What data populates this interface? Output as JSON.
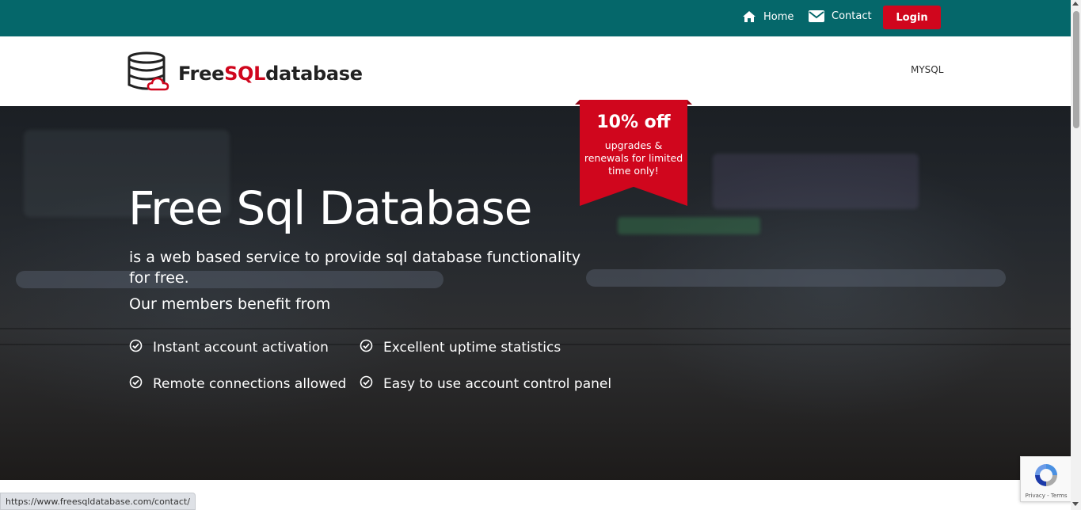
{
  "topbar": {
    "home_label": "Home",
    "contact_label": "Contact",
    "login_label": "Login",
    "background_color": "#05676a",
    "login_color": "#d0061d"
  },
  "header": {
    "logo_prefix": "Free",
    "logo_accent": "SQL",
    "logo_suffix": "database",
    "menu_item": "MYSQL"
  },
  "hero": {
    "title": "Free Sql Database",
    "subtitle": "is a web based service to provide sql database functionality for free.",
    "members_heading": "Our members benefit from",
    "features": [
      "Instant account activation",
      "Excellent uptime statistics",
      "Remote connections allowed",
      "Easy to use account control panel"
    ]
  },
  "promo": {
    "title": "10% off",
    "text": "upgrades & renewals for limited time only!"
  },
  "status_bar": {
    "url": "https://www.freesqldatabase.com/contact/"
  },
  "recaptcha": {
    "links": "Privacy - Terms"
  },
  "icons": {
    "home": "home-icon",
    "contact": "envelope-icon",
    "logo": "database-cloud-icon",
    "feature": "check-circle-icon",
    "recaptcha": "recaptcha-icon"
  }
}
